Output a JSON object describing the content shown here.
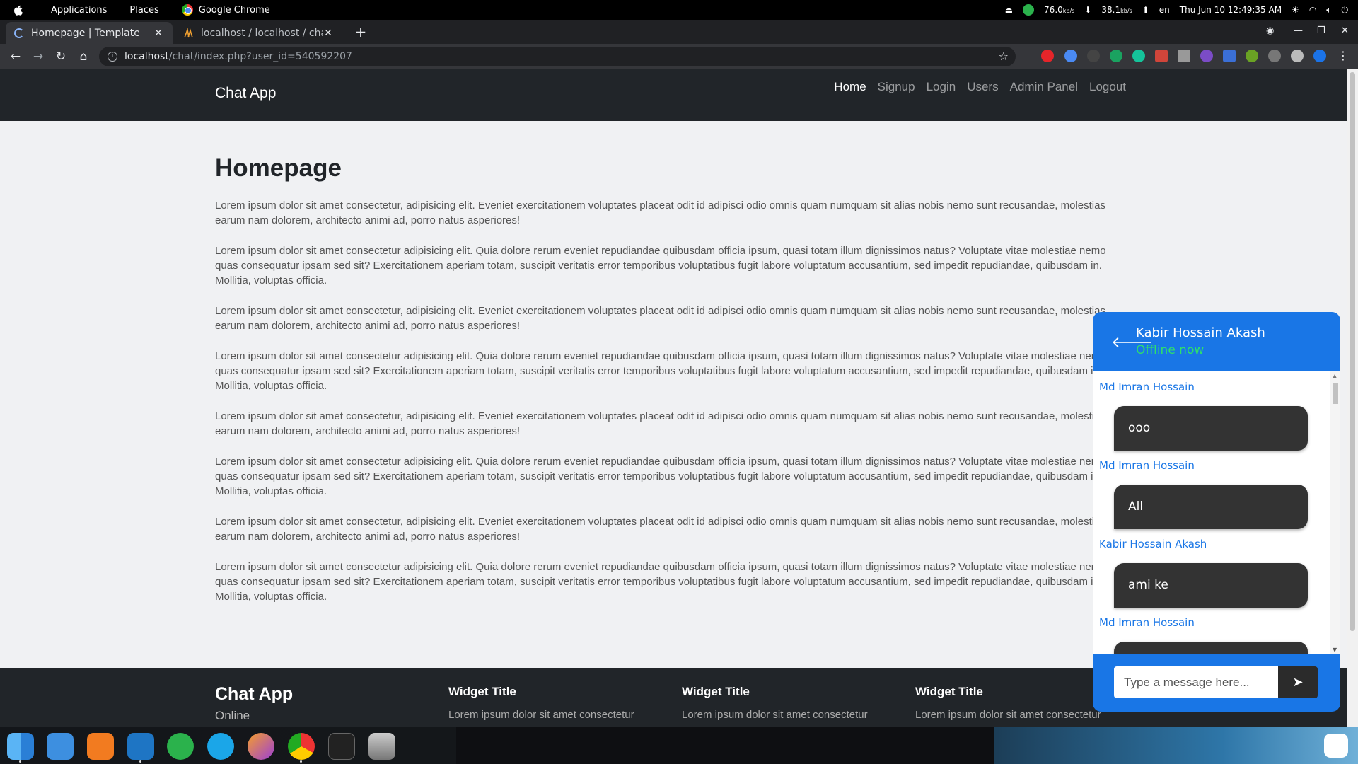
{
  "os_bar": {
    "apps_menu": "Applications",
    "places_menu": "Places",
    "active_app": "Google Chrome",
    "net_down": "76.0",
    "net_down_unit": "kb/s",
    "net_up": "38.1",
    "net_up_unit": "kb/s",
    "lang": "en",
    "datetime": "Thu Jun 10  12:49:35 AM"
  },
  "browser": {
    "tabs": [
      {
        "title": "Homepage | Template"
      },
      {
        "title": "localhost / localhost / cha"
      }
    ],
    "url_host": "localhost",
    "url_path": "/chat/index.php?user_id=540592207"
  },
  "site": {
    "brand": "Chat App",
    "nav": [
      "Home",
      "Signup",
      "Login",
      "Users",
      "Admin Panel",
      "Logout"
    ]
  },
  "main": {
    "title": "Homepage",
    "paragraphs": [
      "Lorem ipsum dolor sit amet consectetur, adipisicing elit. Eveniet exercitationem voluptates placeat odit id adipisci odio omnis quam numquam sit alias nobis nemo sunt recusandae, molestias earum nam dolorem, architecto animi ad, porro natus asperiores!",
      "Lorem ipsum dolor sit amet consectetur adipisicing elit. Quia dolore rerum eveniet repudiandae quibusdam officia ipsum, quasi totam illum dignissimos natus? Voluptate vitae molestiae nemo quas consequatur ipsam sed sit? Exercitationem aperiam totam, suscipit veritatis error temporibus voluptatibus fugit labore voluptatum accusantium, sed impedit repudiandae, quibusdam in. Mollitia, voluptas officia.",
      "Lorem ipsum dolor sit amet consectetur, adipisicing elit. Eveniet exercitationem voluptates placeat odit id adipisci odio omnis quam numquam sit alias nobis nemo sunt recusandae, molestias earum nam dolorem, architecto animi ad, porro natus asperiores!",
      "Lorem ipsum dolor sit amet consectetur adipisicing elit. Quia dolore rerum eveniet repudiandae quibusdam officia ipsum, quasi totam illum dignissimos natus? Voluptate vitae molestiae nemo quas consequatur ipsam sed sit? Exercitationem aperiam totam, suscipit veritatis error temporibus voluptatibus fugit labore voluptatum accusantium, sed impedit repudiandae, quibusdam in. Mollitia, voluptas officia.",
      "Lorem ipsum dolor sit amet consectetur, adipisicing elit. Eveniet exercitationem voluptates placeat odit id adipisci odio omnis quam numquam sit alias nobis nemo sunt recusandae, molestias earum nam dolorem, architecto animi ad, porro natus asperiores!",
      "Lorem ipsum dolor sit amet consectetur adipisicing elit. Quia dolore rerum eveniet repudiandae quibusdam officia ipsum, quasi totam illum dignissimos natus? Voluptate vitae molestiae nemo quas consequatur ipsam sed sit? Exercitationem aperiam totam, suscipit veritatis error temporibus voluptatibus fugit labore voluptatum accusantium, sed impedit repudiandae, quibusdam in. Mollitia, voluptas officia.",
      "Lorem ipsum dolor sit amet consectetur, adipisicing elit. Eveniet exercitationem voluptates placeat odit id adipisci odio omnis quam numquam sit alias nobis nemo sunt recusandae, molestias earum nam dolorem, architecto animi ad, porro natus asperiores!",
      "Lorem ipsum dolor sit amet consectetur adipisicing elit. Quia dolore rerum eveniet repudiandae quibusdam officia ipsum, quasi totam illum dignissimos natus? Voluptate vitae molestiae nemo quas consequatur ipsam sed sit? Exercitationem aperiam totam, suscipit veritatis error temporibus voluptatibus fugit labore voluptatum accusantium, sed impedit repudiandae, quibusdam in. Mollitia, voluptas officia."
    ]
  },
  "footer": {
    "brand": "Chat App",
    "status": "Online",
    "widgets": [
      {
        "title": "Widget Title",
        "text": "Lorem ipsum dolor sit amet consectetur"
      },
      {
        "title": "Widget Title",
        "text": "Lorem ipsum dolor sit amet consectetur"
      },
      {
        "title": "Widget Title",
        "text": "Lorem ipsum dolor sit amet consectetur"
      }
    ]
  },
  "chat": {
    "contact_name": "Kabir Hossain Akash",
    "contact_status": "Offline now",
    "messages": [
      {
        "sender": "Md Imran Hossain",
        "text": "ooo"
      },
      {
        "sender": "Md Imran Hossain",
        "text": "All"
      },
      {
        "sender": "Kabir Hossain Akash",
        "text": "ami ke"
      },
      {
        "sender": "Md Imran Hossain",
        "text": ""
      }
    ],
    "input_placeholder": "Type a message here..."
  },
  "dock": {
    "apps": [
      "finder-icon",
      "mail-icon",
      "xampp-icon",
      "vscode-icon",
      "whatsapp-icon",
      "skype-icon",
      "firefox-icon",
      "chrome-icon",
      "terminal-icon",
      "disk-icon"
    ]
  },
  "colors": {
    "chat_accent": "#1976e6",
    "status_green": "#2ee06a",
    "navbar_bg": "#212529"
  }
}
